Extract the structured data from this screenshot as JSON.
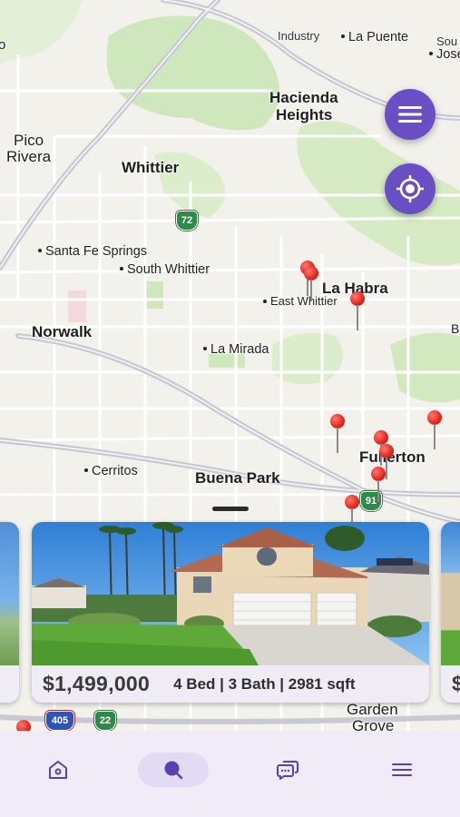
{
  "map": {
    "places": {
      "industry": "Industry",
      "la_puente": "La Puente",
      "south_jose_1": "Sou",
      "south_jose_2": "Jose",
      "left_edge_o": "o",
      "hacienda_heights_1": "Hacienda",
      "hacienda_heights_2": "Heights",
      "pico_rivera_1": "Pico",
      "pico_rivera_2": "Rivera",
      "whittier": "Whittier",
      "santa_fe_springs": "Santa Fe Springs",
      "south_whittier": "South Whittier",
      "la_habra": "La Habra",
      "east_whittier": "East Whittier",
      "norwalk": "Norwalk",
      "la_mirada": "La Mirada",
      "right_edge_b": "B",
      "fullerton": "Fullerton",
      "cerritos": "Cerritos",
      "buena_park": "Buena Park",
      "garden_grove_1": "Garden",
      "garden_grove_2": "Grove"
    },
    "highway_shields": {
      "route_72": "72",
      "route_91": "91",
      "route_405": "405",
      "route_22": "22"
    },
    "colors": {
      "park_green": "#cfe7bc",
      "road": "#ffffff",
      "freeway": "#c9c9d3",
      "pin_red": "#e3241b"
    }
  },
  "fab": {
    "menu_icon": "menu-icon",
    "locate_icon": "locate-icon",
    "color": "#6a4fc4"
  },
  "listings": [
    {
      "price": "$1,499,000",
      "details": "4 Bed | 3 Bath | 2981 sqft"
    },
    {
      "price": "$"
    }
  ],
  "navbar": {
    "items": [
      {
        "icon": "home-icon",
        "active": false
      },
      {
        "icon": "search-icon",
        "active": true
      },
      {
        "icon": "chat-icon",
        "active": false
      },
      {
        "icon": "menu-icon",
        "active": false
      }
    ],
    "accent": "#5a3fb0"
  }
}
